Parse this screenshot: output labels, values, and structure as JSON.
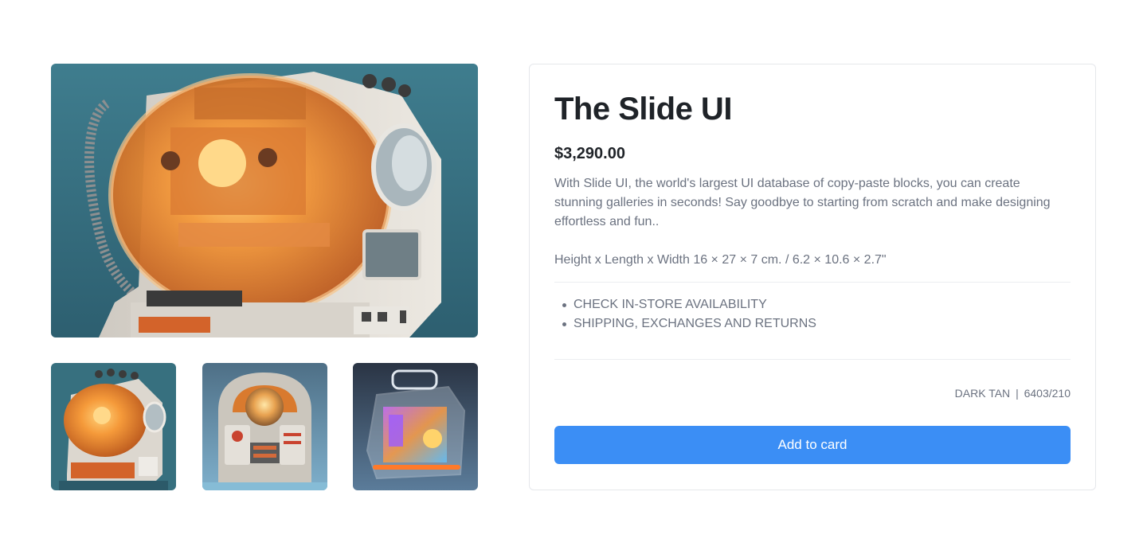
{
  "product": {
    "title": "The Slide UI",
    "price": "$3,290.00",
    "description": "With Slide UI, the world's largest UI database of copy-paste blocks, you can create stunning galleries in seconds! Say goodbye to starting from scratch and make designing effortless and fun..",
    "dimensions": "Height x Length x Width 16 × 27 × 7 cm. / 6.2 × 10.6 × 2.7\"",
    "links": [
      "CHECK IN-STORE AVAILABILITY",
      "SHIPPING, EXCHANGES AND RETURNS"
    ],
    "color_name": "DARK TAN",
    "sku_separator": "|",
    "sku_code": "6403/210",
    "add_button_label": "Add to card"
  },
  "gallery": {
    "main_image": "orange-retro-machine-image",
    "thumbnails": [
      "orange-retro-machine-thumb",
      "retro-console-machine-thumb",
      "transparent-neon-machine-thumb"
    ]
  },
  "colors": {
    "button": "#3b8ef5",
    "title": "#1f2328",
    "muted_text": "#6b7280",
    "border": "#e5e7eb"
  }
}
